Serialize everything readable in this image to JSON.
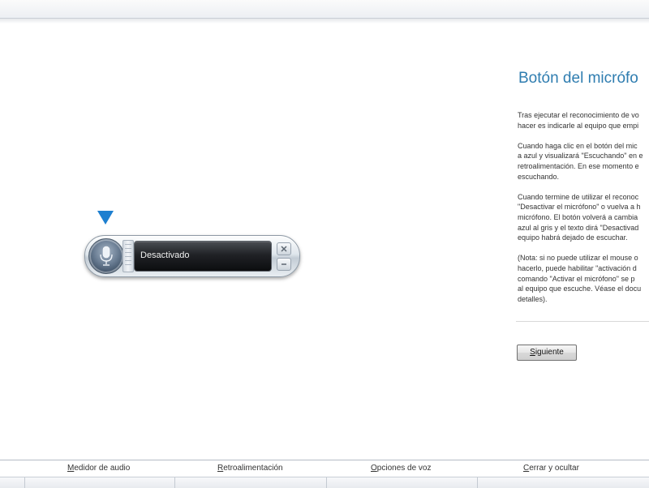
{
  "widget": {
    "status": "Desactivado",
    "mic_icon": "microphone-icon",
    "close_icon": "close-icon",
    "minimize_icon": "minimize-icon"
  },
  "panel": {
    "title": "Botón del micrófo",
    "paragraphs": [
      [
        "Tras ejecutar el reconocimiento de vo",
        "hacer es indicarle al equipo que empi"
      ],
      [
        "Cuando haga clic en el botón del mic",
        "a azul y visualizará \"Escuchando\" en e",
        "retroalimentación. En ese momento e",
        "escuchando."
      ],
      [
        "Cuando termine de utilizar el reconoc",
        "\"Desactivar el micrófono\" o vuelva a h",
        "micrófono. El botón volverá a cambia",
        "azul al gris y el texto dirá \"Desactivad",
        "equipo habrá dejado de escuchar."
      ],
      [
        "(Nota: si no puede utilizar el mouse o",
        "hacerlo, puede habilitar \"activación d",
        "comando \"Activar el micrófono\" se p",
        "al equipo que escuche. Véase el docu",
        "detalles)."
      ]
    ],
    "next_button": {
      "underlined": "S",
      "rest": "iguiente"
    }
  },
  "bottom_links": [
    {
      "underlined": "M",
      "rest": "edidor de audio"
    },
    {
      "underlined": "R",
      "rest": "etroalimentación"
    },
    {
      "underlined": "O",
      "rest": "pciones de voz"
    },
    {
      "underlined": "C",
      "rest": "errar y ocultar"
    }
  ],
  "colors": {
    "title": "#2f7db0",
    "pointer": "#1d7fd0",
    "status_bg": "#0c0d0f"
  }
}
